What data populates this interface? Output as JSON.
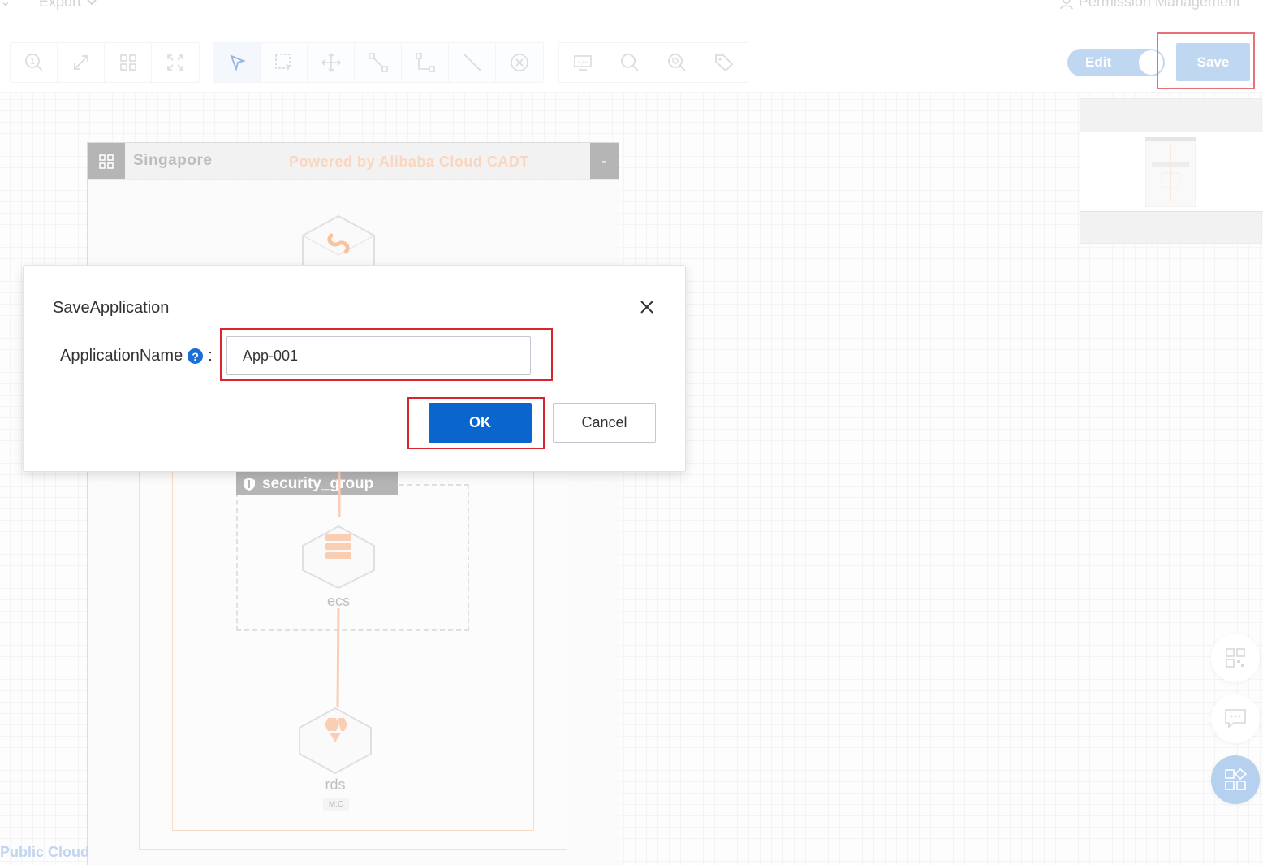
{
  "menubar": {
    "export_label": "Export",
    "permission_label": "Permission Management"
  },
  "toolbar": {
    "edit_label": "Edit",
    "save_label": "Save",
    "edit_on": true
  },
  "canvas": {
    "region_title": "Singapore",
    "powered_by": "Powered by Alibaba Cloud CADT",
    "collapse_label": "-",
    "security_group_label": "security_group",
    "nodes": [
      {
        "label": "ecs"
      },
      {
        "label": "rds",
        "badge": "M:C"
      }
    ],
    "public_cloud_label": "Public Cloud"
  },
  "dialog": {
    "title": "SaveApplication",
    "field_label": "ApplicationName",
    "field_colon": ":",
    "help_glyph": "?",
    "field_value": "App-001",
    "ok_label": "OK",
    "cancel_label": "Cancel"
  },
  "colors": {
    "primary": "#0a65cc",
    "accent_orange": "#f6b48a",
    "highlight_red": "#d9252e",
    "disabled_blue": "#9fc2ec"
  }
}
